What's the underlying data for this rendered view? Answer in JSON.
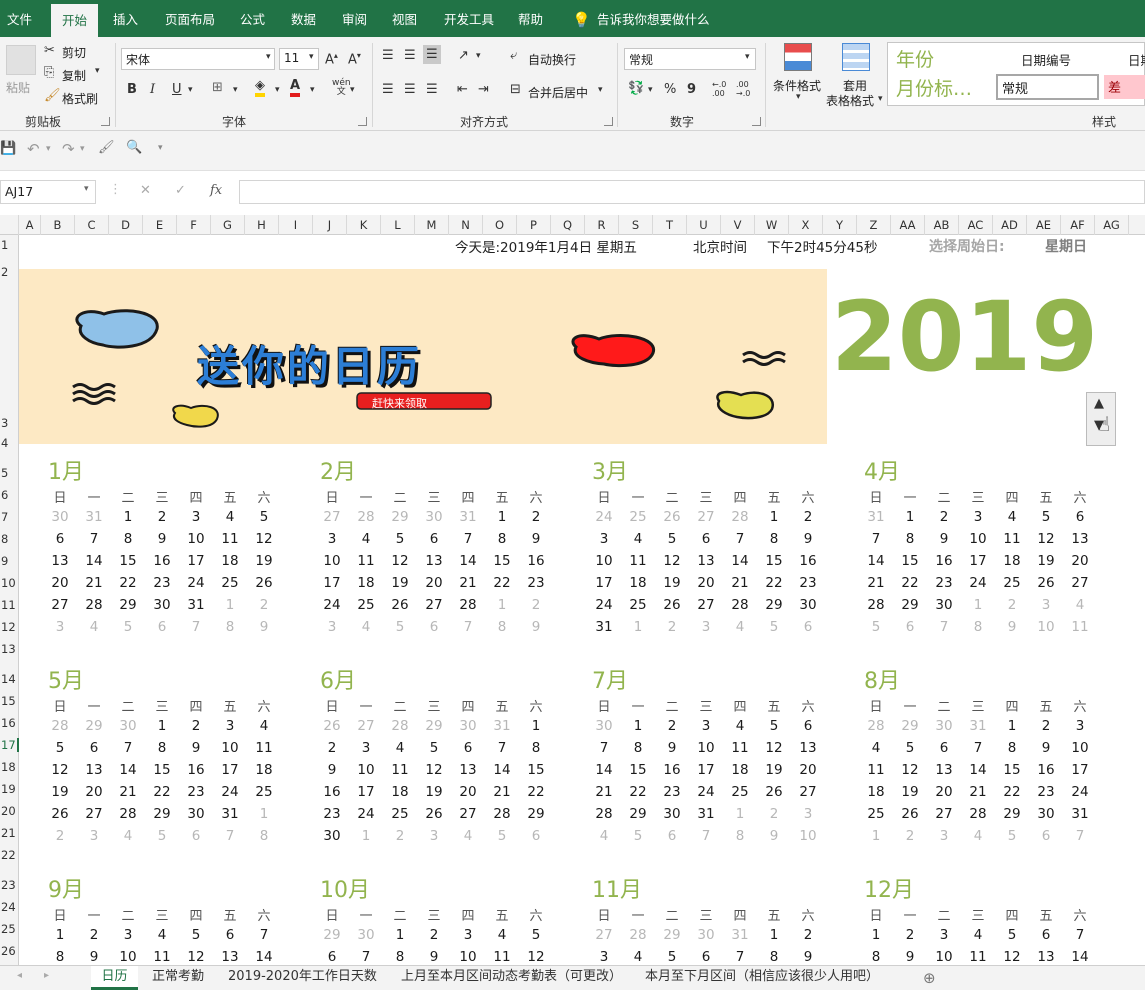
{
  "ribbon_tabs": [
    "文件",
    "开始",
    "插入",
    "页面布局",
    "公式",
    "数据",
    "审阅",
    "视图",
    "开发工具",
    "帮助",
    "告诉我你想要做什么"
  ],
  "clipboard": {
    "paste": "粘贴",
    "cut": "剪切",
    "copy": "复制",
    "format_painter": "格式刷",
    "group": "剪贴板"
  },
  "font": {
    "name": "宋体",
    "size": "11",
    "bold": "B",
    "italic": "I",
    "underline": "U",
    "group": "字体",
    "wen": "wén\n文"
  },
  "alignment": {
    "wrap": "自动换行",
    "merge": "合并后居中",
    "group": "对齐方式"
  },
  "number": {
    "format": "常规",
    "percent": "%",
    "comma": "9",
    "dec_inc": "←.0\n.00",
    "dec_dec": ".00\n→.0",
    "group": "数字"
  },
  "styles": {
    "cond_format": "条件格式",
    "table_format_line1": "套用",
    "table_format_line2": "表格格式",
    "group": "样式",
    "s1": "年份",
    "s2": "日期编号",
    "s3": "日期",
    "s4": "月份标…",
    "s5": "常规",
    "s6": "差"
  },
  "name_box": "AJ17",
  "fx": "fx",
  "columns": [
    "A",
    "B",
    "C",
    "D",
    "E",
    "F",
    "G",
    "H",
    "I",
    "J",
    "K",
    "L",
    "M",
    "N",
    "O",
    "P",
    "Q",
    "R",
    "S",
    "T",
    "U",
    "V",
    "W",
    "X",
    "Y",
    "Z",
    "AA",
    "AB",
    "AC",
    "AD",
    "AE",
    "AF",
    "AG"
  ],
  "rows": [
    "1",
    "2",
    "3",
    "4",
    "5",
    "6",
    "7",
    "8",
    "9",
    "10",
    "11",
    "12",
    "13",
    "14",
    "15",
    "16",
    "17",
    "18",
    "19",
    "20",
    "21",
    "22",
    "23",
    "24",
    "25",
    "26"
  ],
  "header_line": {
    "today": "今天是:2019年1月4日 星期五",
    "beijing": "北京时间",
    "time": "下午2时45分45秒",
    "select_label": "选择周始日:",
    "select_value": "星期日"
  },
  "banner": {
    "title": "送你的日历",
    "button": "赶快来领取"
  },
  "year": "2019",
  "weekdays": [
    "日",
    "一",
    "二",
    "三",
    "四",
    "五",
    "六"
  ],
  "months": [
    {
      "name": "1月",
      "weeks": [
        [
          "30",
          "31",
          "1",
          "2",
          "3",
          "4",
          "5"
        ],
        [
          "6",
          "7",
          "8",
          "9",
          "10",
          "11",
          "12"
        ],
        [
          "13",
          "14",
          "15",
          "16",
          "17",
          "18",
          "19"
        ],
        [
          "20",
          "21",
          "22",
          "23",
          "24",
          "25",
          "26"
        ],
        [
          "27",
          "28",
          "29",
          "30",
          "31",
          "1",
          "2"
        ],
        [
          "3",
          "4",
          "5",
          "6",
          "7",
          "8",
          "9"
        ]
      ],
      "lead": 2
    },
    {
      "name": "2月",
      "weeks": [
        [
          "27",
          "28",
          "29",
          "30",
          "31",
          "1",
          "2"
        ],
        [
          "3",
          "4",
          "5",
          "6",
          "7",
          "8",
          "9"
        ],
        [
          "10",
          "11",
          "12",
          "13",
          "14",
          "15",
          "16"
        ],
        [
          "17",
          "18",
          "19",
          "20",
          "21",
          "22",
          "23"
        ],
        [
          "24",
          "25",
          "26",
          "27",
          "28",
          "1",
          "2"
        ],
        [
          "3",
          "4",
          "5",
          "6",
          "7",
          "8",
          "9"
        ]
      ],
      "lead": 5
    },
    {
      "name": "3月",
      "weeks": [
        [
          "24",
          "25",
          "26",
          "27",
          "28",
          "1",
          "2"
        ],
        [
          "3",
          "4",
          "5",
          "6",
          "7",
          "8",
          "9"
        ],
        [
          "10",
          "11",
          "12",
          "13",
          "14",
          "15",
          "16"
        ],
        [
          "17",
          "18",
          "19",
          "20",
          "21",
          "22",
          "23"
        ],
        [
          "24",
          "25",
          "26",
          "27",
          "28",
          "29",
          "30"
        ],
        [
          "31",
          "1",
          "2",
          "3",
          "4",
          "5",
          "6"
        ]
      ],
      "lead": 5
    },
    {
      "name": "4月",
      "weeks": [
        [
          "31",
          "1",
          "2",
          "3",
          "4",
          "5",
          "6"
        ],
        [
          "7",
          "8",
          "9",
          "10",
          "11",
          "12",
          "13"
        ],
        [
          "14",
          "15",
          "16",
          "17",
          "18",
          "19",
          "20"
        ],
        [
          "21",
          "22",
          "23",
          "24",
          "25",
          "26",
          "27"
        ],
        [
          "28",
          "29",
          "30",
          "1",
          "2",
          "3",
          "4"
        ],
        [
          "5",
          "6",
          "7",
          "8",
          "9",
          "10",
          "11"
        ]
      ],
      "lead": 1
    },
    {
      "name": "5月",
      "weeks": [
        [
          "28",
          "29",
          "30",
          "1",
          "2",
          "3",
          "4"
        ],
        [
          "5",
          "6",
          "7",
          "8",
          "9",
          "10",
          "11"
        ],
        [
          "12",
          "13",
          "14",
          "15",
          "16",
          "17",
          "18"
        ],
        [
          "19",
          "20",
          "21",
          "22",
          "23",
          "24",
          "25"
        ],
        [
          "26",
          "27",
          "28",
          "29",
          "30",
          "31",
          "1"
        ],
        [
          "2",
          "3",
          "4",
          "5",
          "6",
          "7",
          "8"
        ]
      ],
      "lead": 3
    },
    {
      "name": "6月",
      "weeks": [
        [
          "26",
          "27",
          "28",
          "29",
          "30",
          "31",
          "1"
        ],
        [
          "2",
          "3",
          "4",
          "5",
          "6",
          "7",
          "8"
        ],
        [
          "9",
          "10",
          "11",
          "12",
          "13",
          "14",
          "15"
        ],
        [
          "16",
          "17",
          "18",
          "19",
          "20",
          "21",
          "22"
        ],
        [
          "23",
          "24",
          "25",
          "26",
          "27",
          "28",
          "29"
        ],
        [
          "30",
          "1",
          "2",
          "3",
          "4",
          "5",
          "6"
        ]
      ],
      "lead": 6
    },
    {
      "name": "7月",
      "weeks": [
        [
          "30",
          "1",
          "2",
          "3",
          "4",
          "5",
          "6"
        ],
        [
          "7",
          "8",
          "9",
          "10",
          "11",
          "12",
          "13"
        ],
        [
          "14",
          "15",
          "16",
          "17",
          "18",
          "19",
          "20"
        ],
        [
          "21",
          "22",
          "23",
          "24",
          "25",
          "26",
          "27"
        ],
        [
          "28",
          "29",
          "30",
          "31",
          "1",
          "2",
          "3"
        ],
        [
          "4",
          "5",
          "6",
          "7",
          "8",
          "9",
          "10"
        ]
      ],
      "lead": 1
    },
    {
      "name": "8月",
      "weeks": [
        [
          "28",
          "29",
          "30",
          "31",
          "1",
          "2",
          "3"
        ],
        [
          "4",
          "5",
          "6",
          "7",
          "8",
          "9",
          "10"
        ],
        [
          "11",
          "12",
          "13",
          "14",
          "15",
          "16",
          "17"
        ],
        [
          "18",
          "19",
          "20",
          "21",
          "22",
          "23",
          "24"
        ],
        [
          "25",
          "26",
          "27",
          "28",
          "29",
          "30",
          "31"
        ],
        [
          "1",
          "2",
          "3",
          "4",
          "5",
          "6",
          "7"
        ]
      ],
      "lead": 4
    },
    {
      "name": "9月",
      "weeks": [
        [
          "1",
          "2",
          "3",
          "4",
          "5",
          "6",
          "7"
        ],
        [
          "8",
          "9",
          "10",
          "11",
          "12",
          "13",
          "14"
        ]
      ],
      "lead": 0
    },
    {
      "name": "10月",
      "weeks": [
        [
          "29",
          "30",
          "1",
          "2",
          "3",
          "4",
          "5"
        ],
        [
          "6",
          "7",
          "8",
          "9",
          "10",
          "11",
          "12"
        ]
      ],
      "lead": 2
    },
    {
      "name": "11月",
      "weeks": [
        [
          "27",
          "28",
          "29",
          "30",
          "31",
          "1",
          "2"
        ],
        [
          "3",
          "4",
          "5",
          "6",
          "7",
          "8",
          "9"
        ]
      ],
      "lead": 5
    },
    {
      "name": "12月",
      "weeks": [
        [
          "1",
          "2",
          "3",
          "4",
          "5",
          "6",
          "7"
        ],
        [
          "8",
          "9",
          "10",
          "11",
          "12",
          "13",
          "14"
        ]
      ],
      "lead": 0
    }
  ],
  "sheet_tabs": [
    "日历",
    "正常考勤",
    "2019-2020年工作日天数",
    "上月至本月区间动态考勤表（可更改）",
    "本月至下月区间（相信应该很少人用吧）"
  ],
  "colors": {
    "excel_green": "#217346",
    "calendar_green": "#92b44e",
    "banner_bg": "#fde9c4"
  }
}
